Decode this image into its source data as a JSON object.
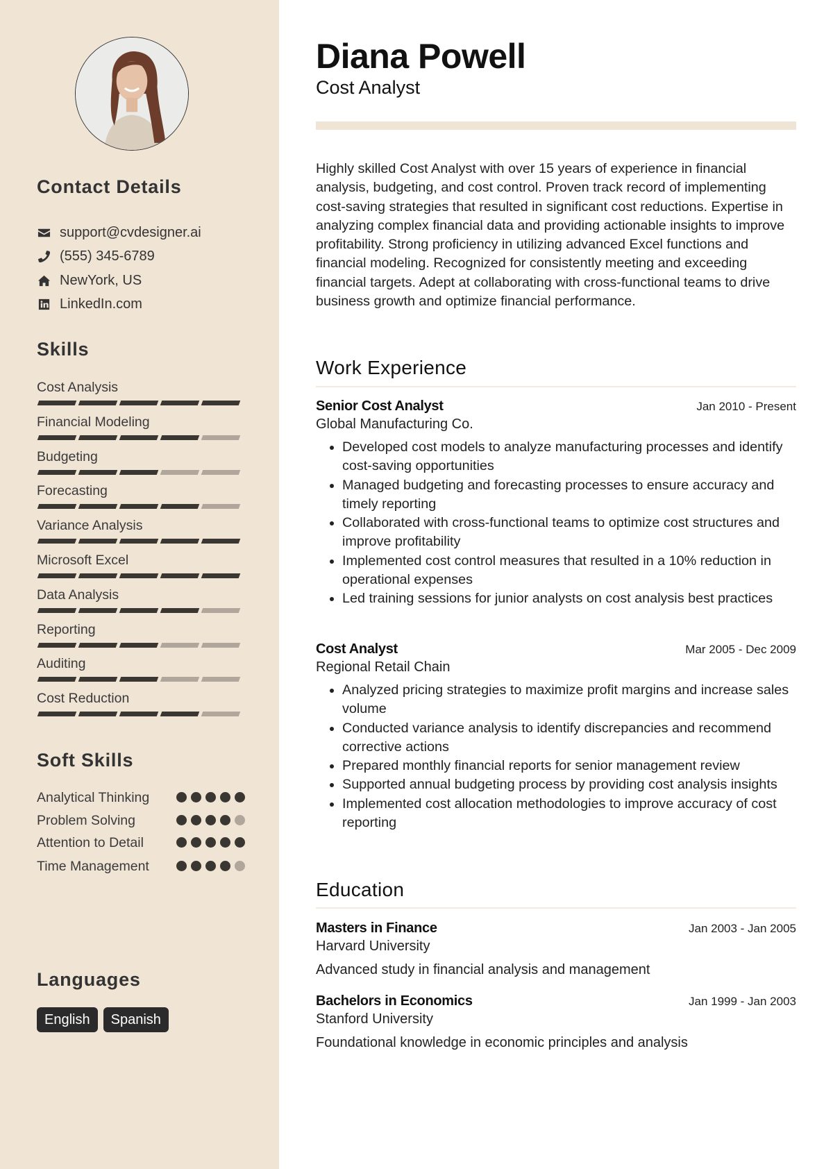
{
  "profile": {
    "name": "Diana Powell",
    "title": "Cost Analyst",
    "photo_alt": "Profile photo of Diana Powell"
  },
  "sidebar": {
    "contact": {
      "heading": "Contact Details",
      "items": [
        {
          "icon": "envelope-icon",
          "text": "support@cvdesigner.ai"
        },
        {
          "icon": "phone-icon",
          "text": "(555) 345-6789"
        },
        {
          "icon": "home-icon",
          "text": "NewYork, US"
        },
        {
          "icon": "linkedin-icon",
          "text": "LinkedIn.com"
        }
      ]
    },
    "skills": {
      "heading": "Skills",
      "max_level": 5,
      "items": [
        {
          "name": "Cost Analysis",
          "level": 5
        },
        {
          "name": "Financial Modeling",
          "level": 4
        },
        {
          "name": "Budgeting",
          "level": 3
        },
        {
          "name": "Forecasting",
          "level": 4
        },
        {
          "name": "Variance Analysis",
          "level": 5
        },
        {
          "name": "Microsoft Excel",
          "level": 5
        },
        {
          "name": "Data Analysis",
          "level": 4
        },
        {
          "name": "Reporting",
          "level": 3
        },
        {
          "name": "Auditing",
          "level": 3
        },
        {
          "name": "Cost Reduction",
          "level": 4
        }
      ]
    },
    "soft_skills": {
      "heading": "Soft Skills",
      "max_level": 5,
      "items": [
        {
          "name": "Analytical Thinking",
          "level": 5
        },
        {
          "name": "Problem Solving",
          "level": 4
        },
        {
          "name": "Attention to Detail",
          "level": 5
        },
        {
          "name": "Time Management",
          "level": 4
        }
      ]
    },
    "languages": {
      "heading": "Languages",
      "items": [
        "English",
        "Spanish"
      ]
    }
  },
  "summary": "Highly skilled Cost Analyst with over 15 years of experience in financial analysis, budgeting, and cost control. Proven track record of implementing cost-saving strategies that resulted in significant cost reductions. Expertise in analyzing complex financial data and providing actionable insights to improve profitability. Strong proficiency in utilizing advanced Excel functions and financial modeling. Recognized for consistently meeting and exceeding financial targets. Adept at collaborating with cross-functional teams to drive business growth and optimize financial performance.",
  "work": {
    "heading": "Work Experience",
    "entries": [
      {
        "title": "Senior Cost Analyst",
        "dates": "Jan 2010 - Present",
        "company": "Global Manufacturing Co.",
        "bullets": [
          "Developed cost models to analyze manufacturing processes and identify cost-saving opportunities",
          "Managed budgeting and forecasting processes to ensure accuracy and timely reporting",
          "Collaborated with cross-functional teams to optimize cost structures and improve profitability",
          "Implemented cost control measures that resulted in a 10% reduction in operational expenses",
          "Led training sessions for junior analysts on cost analysis best practices"
        ]
      },
      {
        "title": "Cost Analyst",
        "dates": "Mar 2005 - Dec 2009",
        "company": "Regional Retail Chain",
        "bullets": [
          "Analyzed pricing strategies to maximize profit margins and increase sales volume",
          "Conducted variance analysis to identify discrepancies and recommend corrective actions",
          "Prepared monthly financial reports for senior management review",
          "Supported annual budgeting process by providing cost analysis insights",
          "Implemented cost allocation methodologies to improve accuracy of cost reporting"
        ]
      }
    ]
  },
  "education": {
    "heading": "Education",
    "entries": [
      {
        "degree": "Masters in Finance",
        "dates": "Jan 2003 - Jan 2005",
        "school": "Harvard University",
        "description": "Advanced study in financial analysis and management"
      },
      {
        "degree": "Bachelors in Economics",
        "dates": "Jan 1999 - Jan 2003",
        "school": "Stanford University",
        "description": "Foundational knowledge in economic principles and analysis"
      }
    ]
  },
  "colors": {
    "sidebar_bg": "#f0e4d5",
    "accent": "#f0e4d5",
    "level_on": "#3a3632",
    "level_off": "#b0a69b",
    "tag_bg": "#2b2b2b"
  }
}
